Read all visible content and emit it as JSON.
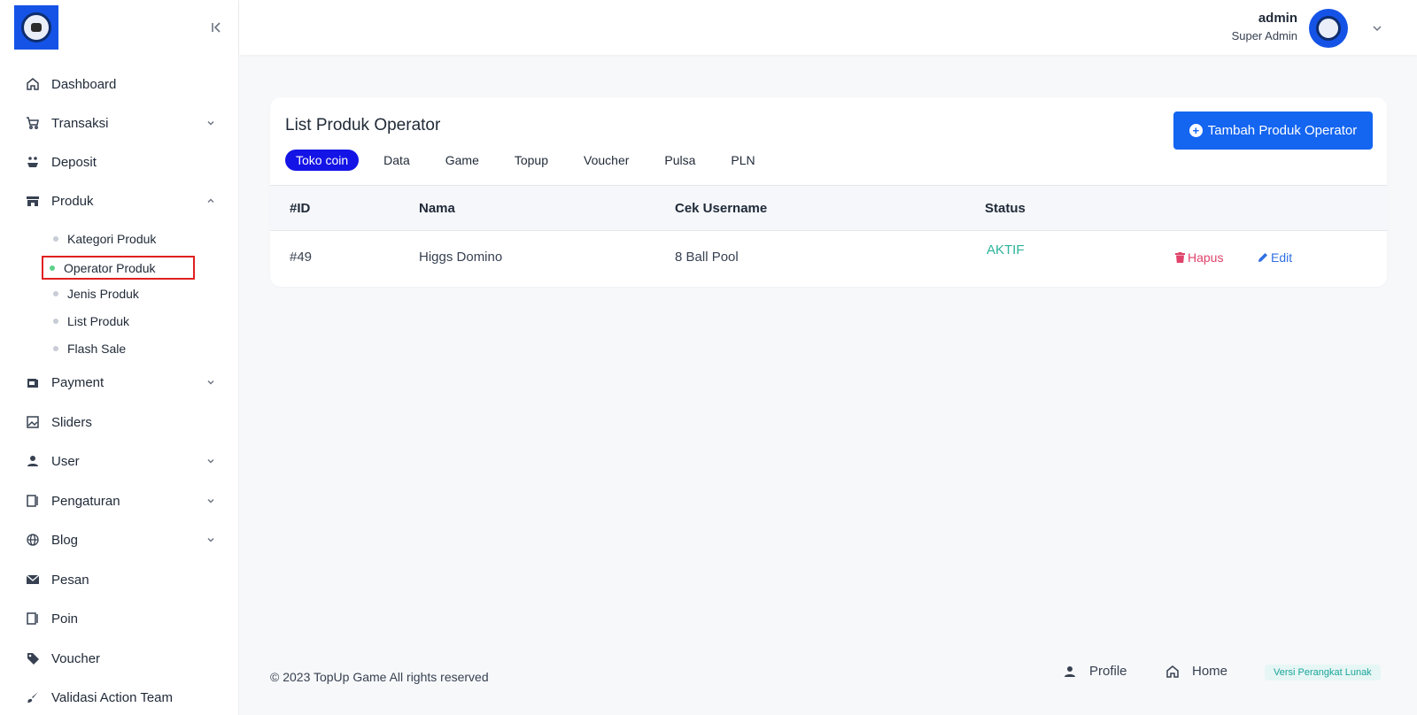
{
  "sidebar": {
    "items": [
      {
        "label": "Dashboard"
      },
      {
        "label": "Transaksi"
      },
      {
        "label": "Deposit"
      },
      {
        "label": "Produk"
      },
      {
        "label": "Payment"
      },
      {
        "label": "Sliders"
      },
      {
        "label": "User"
      },
      {
        "label": "Pengaturan"
      },
      {
        "label": "Blog"
      },
      {
        "label": "Pesan"
      },
      {
        "label": "Poin"
      },
      {
        "label": "Voucher"
      },
      {
        "label": "Validasi Action Team"
      }
    ],
    "produk_sub": [
      {
        "label": "Kategori Produk"
      },
      {
        "label": "Operator Produk"
      },
      {
        "label": "Jenis Produk"
      },
      {
        "label": "List Produk"
      },
      {
        "label": "Flash Sale"
      }
    ]
  },
  "topbar": {
    "user_name": "admin",
    "user_role": "Super Admin"
  },
  "card": {
    "title": "List Produk Operator",
    "add_button": "Tambah Produk Operator",
    "tabs": [
      {
        "label": "Toko coin"
      },
      {
        "label": "Data"
      },
      {
        "label": "Game"
      },
      {
        "label": "Topup"
      },
      {
        "label": "Voucher"
      },
      {
        "label": "Pulsa"
      },
      {
        "label": "PLN"
      }
    ],
    "columns": [
      "#ID",
      "Nama",
      "Cek Username",
      "Status"
    ],
    "rows": [
      {
        "id": "#49",
        "nama": "Higgs Domino",
        "cek_username": "8 Ball Pool",
        "status": "AKTIF",
        "delete": "Hapus",
        "edit": "Edit"
      }
    ]
  },
  "footer": {
    "copyright": "© 2023 TopUp Game All rights reserved",
    "profile": "Profile",
    "home": "Home",
    "version": "Versi Perangkat Lunak"
  },
  "colors": {
    "primary": "#1465f0",
    "active_tab": "#1414e6",
    "status_active": "#2bb39a",
    "delete": "#e0436b",
    "edit": "#2f6fe4",
    "highlight_box": "#e02020"
  }
}
